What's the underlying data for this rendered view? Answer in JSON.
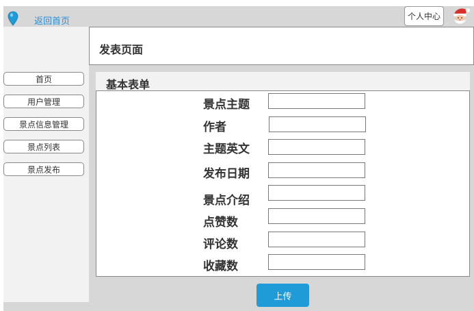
{
  "topbar": {
    "back_label": "返回首页",
    "user_center_label": "个人中心"
  },
  "sidebar": {
    "items": [
      {
        "label": "首页"
      },
      {
        "label": "用户管理"
      },
      {
        "label": "景点信息管理"
      },
      {
        "label": "景点列表"
      },
      {
        "label": "景点发布"
      }
    ]
  },
  "page": {
    "title": "发表页面"
  },
  "form": {
    "title": "基本表单",
    "fields": [
      {
        "label": "景点主题",
        "value": ""
      },
      {
        "label": "作者",
        "value": ""
      },
      {
        "label": "主题英文",
        "value": ""
      },
      {
        "label": "发布日期",
        "value": ""
      },
      {
        "label": "景点介绍",
        "value": ""
      },
      {
        "label": "点赞数",
        "value": ""
      },
      {
        "label": "评论数",
        "value": ""
      },
      {
        "label": "收藏数",
        "value": ""
      }
    ],
    "submit_label": "上传"
  },
  "colors": {
    "accent": "#1f9bd7",
    "link": "#2a8fd6",
    "background": "#d7d7d7",
    "panel": "#f2f2f2"
  },
  "icons": {
    "location": "location-pin-icon",
    "avatar": "santa-avatar-icon"
  }
}
